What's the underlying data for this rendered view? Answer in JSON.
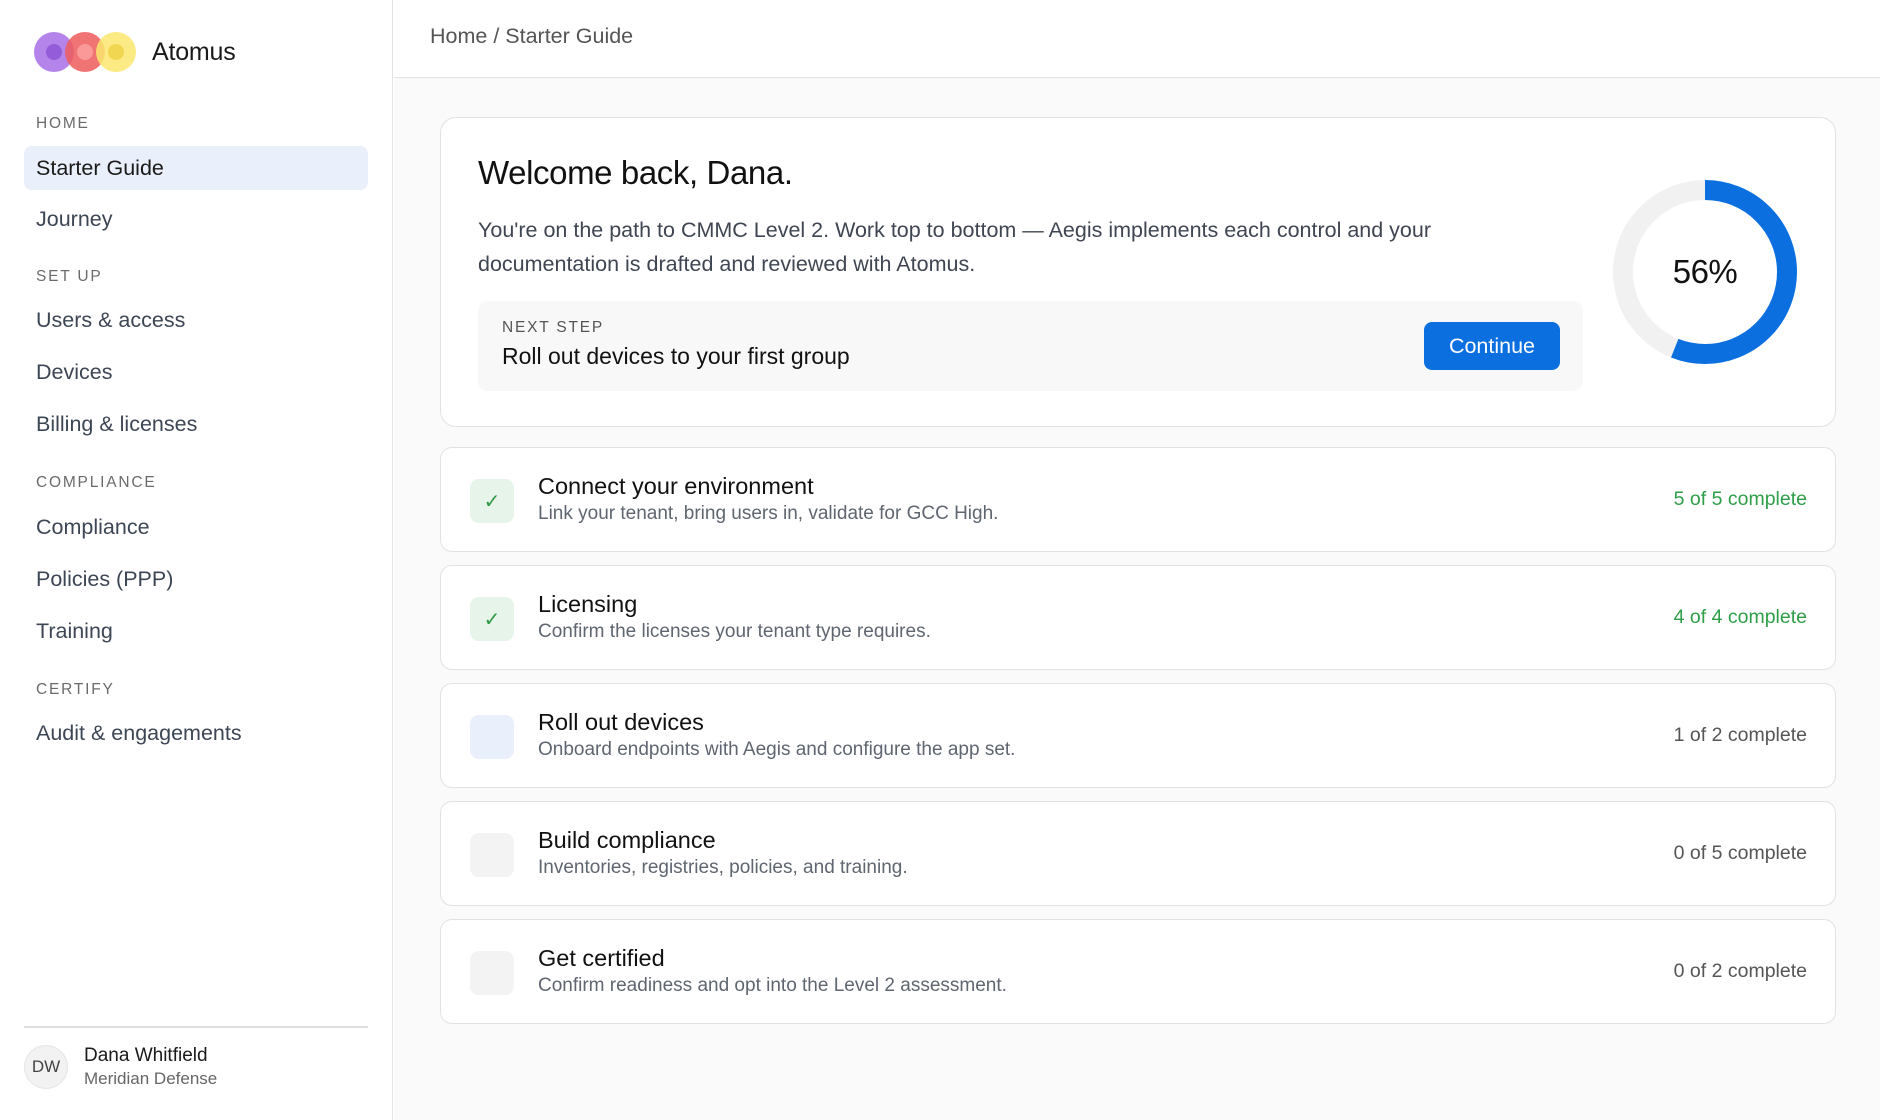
{
  "app": {
    "name": "Atomus"
  },
  "sidebar": {
    "sections": [
      {
        "label": "HOME"
      },
      {
        "label": "SET UP"
      },
      {
        "label": "COMPLIANCE"
      },
      {
        "label": "CERTIFY"
      }
    ],
    "items": [
      {
        "label": "Starter Guide",
        "active": true
      },
      {
        "label": "Journey"
      },
      {
        "label": "Users & access"
      },
      {
        "label": "Devices"
      },
      {
        "label": "Billing & licenses"
      },
      {
        "label": "Compliance"
      },
      {
        "label": "Policies (PPP)"
      },
      {
        "label": "Training"
      },
      {
        "label": "Audit & engagements"
      }
    ],
    "user": {
      "initials": "DW",
      "name": "Dana Whitfield",
      "org": "Meridian Defense"
    }
  },
  "header": {
    "breadcrumb": "Home / Starter Guide"
  },
  "welcome": {
    "title": "Welcome back, Dana.",
    "description": "You're on the path to CMMC Level 2. Work top to bottom — Aegis implements each control and your documentation is drafted and reviewed with Atomus.",
    "next_step_label": "NEXT STEP",
    "next_step_title": "Roll out devices to your first group",
    "continue_label": "Continue",
    "progress_percent": 56,
    "progress_label": "56%",
    "progress_color": "#0b6fe0",
    "progress_track_color": "#f1f1f1"
  },
  "steps": [
    {
      "title": "Connect your environment",
      "description": "Link your tenant, bring users in, validate for GCC High.",
      "status": "5 of 5 complete",
      "state": "done",
      "icon": "check-icon"
    },
    {
      "title": "Licensing",
      "description": "Confirm the licenses your tenant type requires.",
      "status": "4 of 4 complete",
      "state": "done",
      "icon": "check-icon"
    },
    {
      "title": "Roll out devices",
      "description": "Onboard endpoints with Aegis and configure the app set.",
      "status": "1 of 2 complete",
      "state": "active"
    },
    {
      "title": "Build compliance",
      "description": "Inventories, registries, policies, and training.",
      "status": "0 of 5 complete",
      "state": "todo"
    },
    {
      "title": "Get certified",
      "description": "Confirm readiness and opt into the Level 2 assessment.",
      "status": "0 of 2 complete",
      "state": "todo"
    }
  ],
  "colors": {
    "accent": "#0b6fe0",
    "success": "#2e9e48"
  }
}
